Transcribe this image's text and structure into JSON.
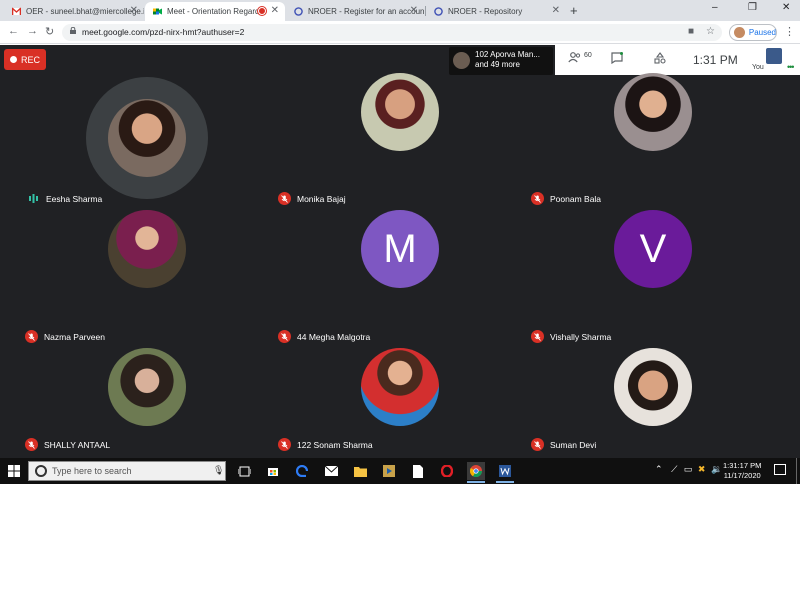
{
  "browser": {
    "tabs": [
      {
        "title": "OER - suneel.bhat@miercollege.i",
        "active": false
      },
      {
        "title": "Meet - Orientation Regardin",
        "active": true
      },
      {
        "title": "NROER - Register for an account",
        "active": false
      },
      {
        "title": "NROER - Repository",
        "active": false
      }
    ],
    "new_tab": "+",
    "url": "meet.google.com/pzd-nirx-hmt?authuser=2",
    "profile_status": "Paused",
    "window_controls": {
      "minimize": "–",
      "restore": "❐",
      "close": "✕"
    }
  },
  "meet": {
    "rec_label": "REC",
    "participants_banner": {
      "line1": "102 Aporva Man...",
      "line2": "and 49 more"
    },
    "participant_count": "60",
    "clock": "1:31 PM",
    "self_label": "You",
    "tiles": [
      {
        "name": "Eesha Sharma",
        "type": "photo",
        "speaking": true,
        "muted": false
      },
      {
        "name": "Monika Bajaj",
        "type": "photo",
        "speaking": false,
        "muted": true
      },
      {
        "name": "Poonam Bala",
        "type": "photo",
        "speaking": false,
        "muted": true
      },
      {
        "name": "Nazma Parveen",
        "type": "photo",
        "speaking": false,
        "muted": true
      },
      {
        "name": "44 Megha Malgotra",
        "type": "letter",
        "letter": "M",
        "color": "#7e57c2",
        "speaking": false,
        "muted": true
      },
      {
        "name": "Vishally Sharma",
        "type": "letter",
        "letter": "V",
        "color": "#6a1b9a",
        "speaking": false,
        "muted": true
      },
      {
        "name": "SHALLY ANTAAL",
        "type": "photo",
        "speaking": false,
        "muted": true
      },
      {
        "name": "122 Sonam Sharma",
        "type": "photo",
        "speaking": false,
        "muted": true
      },
      {
        "name": "Suman Devi",
        "type": "photo",
        "speaking": false,
        "muted": true
      }
    ]
  },
  "taskbar": {
    "search_placeholder": "Type here to search",
    "time": "1:31:17 PM",
    "date": "11/17/2020",
    "apps": [
      "task-view-icon",
      "store-icon",
      "edge-icon",
      "mail-icon",
      "file-explorer-icon",
      "media-player-icon",
      "file-icon",
      "opera-icon",
      "chrome-icon",
      "word-icon"
    ]
  },
  "colors": {
    "meet_bg": "#202124",
    "mic_off_red": "#d93025",
    "rec_red": "#d93025",
    "taskbar_bg": "#101010"
  }
}
